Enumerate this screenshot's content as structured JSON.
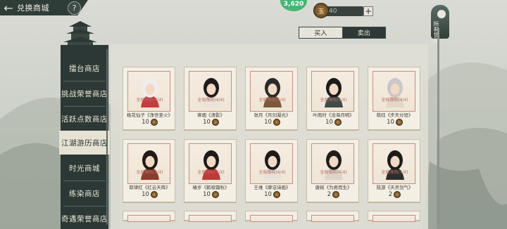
{
  "header": {
    "back_symbol": "←",
    "title": "兑换商城",
    "help_symbol": "?"
  },
  "top_resources": {
    "gem_value": "3,620",
    "currency_value": "40",
    "currency_glyph": "玉",
    "plus_label": "+"
  },
  "right_panel": {
    "label": "所有货币"
  },
  "tabs": [
    {
      "label": "买入",
      "active": true
    },
    {
      "label": "卖出",
      "active": false
    }
  ],
  "sidebar": {
    "items": [
      {
        "label": "擂台商店",
        "active": false
      },
      {
        "label": "挑战荣誉商店",
        "active": false
      },
      {
        "label": "活跃点数商店",
        "active": false
      },
      {
        "label": "江湖游历商店",
        "active": true
      },
      {
        "label": "时光商城",
        "active": false
      },
      {
        "label": "练染商店",
        "active": false
      },
      {
        "label": "奇遇荣誉商店",
        "active": false
      }
    ]
  },
  "cards": [
    {
      "tag": "全局限购(4/4)",
      "name": "桃花仙子《净世圣火》",
      "price": "10",
      "hair": "#eeeeee",
      "robe": "#c63b3b"
    },
    {
      "tag": "全局限购(4/4)",
      "name": "寒烟《清影》",
      "price": "10",
      "hair": "#1e1b1a",
      "robe": "#e9e3da"
    },
    {
      "tag": "全局限购(4/4)",
      "name": "张月《月剑凝光》",
      "price": "10",
      "hair": "#2a2a2a",
      "robe": "#7c5a3a"
    },
    {
      "tag": "全局限购(4/4)",
      "name": "叶雨时《沧海月明》",
      "price": "10",
      "hair": "#1b1b1b",
      "robe": "#3d4d48"
    },
    {
      "tag": "全局限购(4/4)",
      "name": "萌珏《步天分垣》",
      "price": "10",
      "hair": "#c9c7c8",
      "robe": "#e2d7c8"
    },
    {
      "tag": "全局限购(4/4)",
      "name": "耶律红《红云天降》",
      "price": "10",
      "hair": "#231a16",
      "robe": "#8d3c2b"
    },
    {
      "tag": "全局限购(4/4)",
      "name": "椿岁《鹤唳霜秋》",
      "price": "10",
      "hair": "#1d1a19",
      "robe": "#c73535"
    },
    {
      "tag": "全局限购(4/4)",
      "name": "王维《摩诘诗画》",
      "price": "10",
      "hair": "#1b1b1b",
      "robe": "#e6e1d8"
    },
    {
      "tag": "全局限购(4/4)",
      "name": "唐婉《为君而生》",
      "price": "2",
      "hair": "#1f1d1b",
      "robe": "#dcd6ca"
    },
    {
      "tag": "全局限购(4/4)",
      "name": "陆游《天灵剑气》",
      "price": "2",
      "hair": "#1c1b1a",
      "robe": "#2b2e2c"
    }
  ]
}
